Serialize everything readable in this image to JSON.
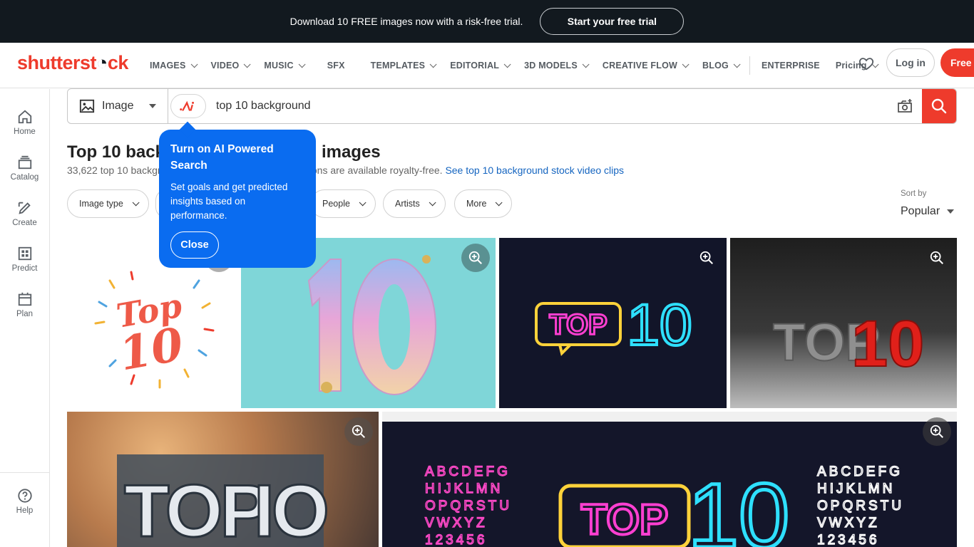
{
  "promo": {
    "text": "Download 10 FREE images now with a risk-free trial.",
    "cta": "Start your free trial"
  },
  "header": {
    "logo_a": "shutterst",
    "logo_b": "ck",
    "nav": [
      "IMAGES",
      "VIDEO",
      "MUSIC",
      "SFX",
      "TEMPLATES",
      "EDITORIAL",
      "3D MODELS",
      "CREATIVE FLOW",
      "BLOG"
    ],
    "enterprise": "ENTERPRISE",
    "pricing": "Pricing",
    "login": "Log in",
    "free": "Free t"
  },
  "sidebar": {
    "items": [
      "Home",
      "Catalog",
      "Create",
      "Predict",
      "Plan"
    ],
    "help": "Help"
  },
  "search": {
    "type": "Image",
    "ai_label": ".Ξi",
    "query": "top 10 background"
  },
  "results": {
    "title_a": "Top 10 back",
    "title_b": "images",
    "count_a": "33,622 top 10 backgr",
    "count_b": "strations are available royalty-free.",
    "video_link": "See top 10 background stock video clips"
  },
  "filters": [
    "Image type",
    "People",
    "Artists",
    "More"
  ],
  "sort": {
    "label": "Sort by",
    "value": "Popular"
  },
  "tooltip": {
    "title": "Turn on AI Powered Search",
    "body": "Set goals and get predicted insights based on performance.",
    "close": "Close"
  },
  "images": {
    "img1_text": "Top 10",
    "img2_text": "10",
    "img3_text": "TOP10",
    "img4_text": "TOP10",
    "img5_text": "TOP10",
    "img6_text": "TOP10",
    "alpha_rows": [
      "ABCDEFG",
      "HIJKLMN",
      "OPQRSTU",
      "VWXYZ",
      "123456"
    ]
  },
  "colors": {
    "brand": "#ee3b2c",
    "promo_bg": "#12191f",
    "tooltip_bg": "#0a6cf0",
    "link": "#1565c0"
  }
}
